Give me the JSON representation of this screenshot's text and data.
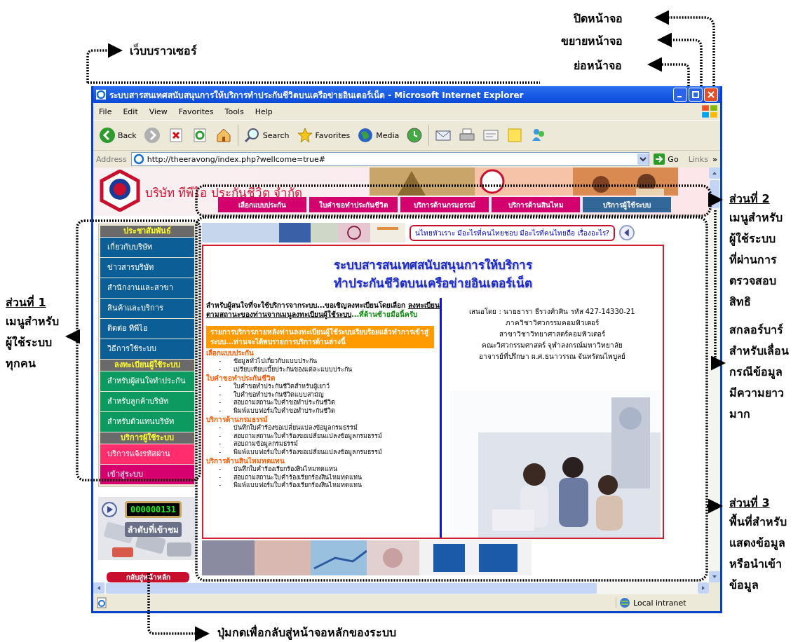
{
  "annotations": [
    {
      "kind": "plain",
      "lines": [
        "ปิดหน้าจอ"
      ]
    },
    {
      "kind": "plain",
      "lines": [
        "ขยายหน้าจอ"
      ]
    },
    {
      "kind": "plain",
      "lines": [
        "ย่อหน้าจอ"
      ]
    },
    {
      "kind": "plain",
      "lines": [
        "เว็บบราวเซอร์"
      ]
    },
    {
      "kind": "section",
      "heading": "ส่วนที่ 2",
      "lines": [
        "เมนูสำหรับ",
        "ผู้ใช้ระบบ",
        "ที่ผ่านการ",
        "ตรวจสอบ",
        "สิทธิ"
      ]
    },
    {
      "kind": "plain",
      "lines": [
        "สกลอร์บาร์",
        "สำหรับเลื่อน",
        "กรณีข้อมูล",
        "มีความยาว",
        "มาก"
      ]
    },
    {
      "kind": "section",
      "heading": "ส่วนที่ 3",
      "lines": [
        "พื้นที่สำหรับ",
        "แสดงข้อมูล",
        "หรือนำเข้า",
        "ข้อมูล"
      ]
    },
    {
      "kind": "section",
      "heading": "ส่วนที่ 1",
      "lines": [
        "เมนูสำหรับ",
        "ผู้ใช้ระบบ",
        "ทุกคน"
      ]
    },
    {
      "kind": "plain",
      "lines": [
        "ปุ่มกดเพื่อกลับสู่หน้าจอหลักของระบบ"
      ]
    }
  ],
  "browser": {
    "title": "ระบบสารสนเทศสนับสนุนการให้บริการทำประกันชีวิตบนเครือข่ายอินเตอร์เน็ต - Microsoft Internet Explorer",
    "menu": [
      "File",
      "Edit",
      "View",
      "Favorites",
      "Tools",
      "Help"
    ],
    "toolbar": [
      {
        "kind": "back",
        "label": "Back"
      },
      {
        "kind": "forward"
      },
      {
        "kind": "stop"
      },
      {
        "kind": "refresh"
      },
      {
        "kind": "home"
      },
      {
        "kind": "search",
        "label": "Search"
      },
      {
        "kind": "favorites",
        "label": "Favorites"
      },
      {
        "kind": "media",
        "label": "Media"
      },
      {
        "kind": "history"
      },
      {
        "kind": "mail"
      },
      {
        "kind": "print"
      },
      {
        "kind": "edit"
      },
      {
        "kind": "note"
      },
      {
        "kind": "messenger"
      }
    ],
    "address": {
      "label": "Address",
      "url": "http://theeravong/index.php?wellcome=true#",
      "go": "Go",
      "links": "Links",
      "more": "»"
    },
    "status": "Local intranet"
  },
  "site": {
    "company": "บริษัท ทีพีไอ ประกันชีวิต จำกัด",
    "tabs": [
      {
        "label": "เลือกแบบประกัน",
        "selected": false
      },
      {
        "label": "ใบคำขอทำประกันชีวิต",
        "selected": false
      },
      {
        "label": "บริการด้านกรมธรรม์",
        "selected": false
      },
      {
        "label": "บริการด้านสินไหม",
        "selected": false
      },
      {
        "label": "บริการผู้ใช้ระบบ",
        "selected": true
      }
    ],
    "sidebar": [
      {
        "title": "ประชาสัมพันธ์",
        "items": [
          {
            "label": "เกี่ยวกับบริษัท",
            "color": "#0b5e96"
          },
          {
            "label": "ข่าวสารบริษัท",
            "color": "#0b5e96"
          },
          {
            "label": "สำนักงานและสาขา",
            "color": "#0b5e96"
          },
          {
            "label": "สินค้าและบริการ",
            "color": "#0b5e96"
          },
          {
            "label": "ติดต่อ ทีพีไอ",
            "color": "#0b5e96"
          },
          {
            "label": "วิธีการใช้ระบบ",
            "color": "#0b5e96"
          }
        ]
      },
      {
        "title": "ลงทะเบียนผู้ใช้ระบบ",
        "items": [
          {
            "label": "สำหรับผู้สนใจทำประกัน",
            "color": "#0d9a60"
          },
          {
            "label": "สำหรับลูกค้าบริษัท",
            "color": "#0d9a60"
          },
          {
            "label": "สำหรับตัวแทนบริษัท",
            "color": "#0d9a60"
          }
        ]
      },
      {
        "title": "บริการผู้ใช้ระบบ",
        "items": [
          {
            "label": "บริการแจ้งรหัสผ่าน",
            "color": "#ff2d6e"
          },
          {
            "label": "เข้าสู่ระบบ",
            "color": "#d6006e"
          }
        ]
      }
    ],
    "counter": {
      "value": "000000131",
      "label": "ลำดับที่เข้าชม"
    },
    "home_button": "กลับสู่หน้าหลัก",
    "ticker": "นไทยหัวเราะ มีอะไรที่คนไทยชอบ มีอะไรที่คนไทยถือ เรื่องอะไร?",
    "main": {
      "bullet": "-",
      "title": [
        "ระบบสารสนเทศสนับสนุนการให้บริการ",
        "ทำประกันชีวิตบนเครือข่ายอินเตอร์เน็ต"
      ],
      "intro": [
        {
          "kind": "plain",
          "text": "สำหรับผู้สนใจที่จะใช้บริการจากระบบ...ขอเชิญลงทะเบียนโดยเลือก "
        },
        {
          "kind": "underline",
          "text": "ลงทะเบียนตามสถานะของท่านจากเมนูลงทะเบียนผู้ใช้ระบบ"
        },
        {
          "kind": "green",
          "text": "...ที่ด้านซ้ายมือนี้ครับ"
        }
      ],
      "notice": "รายการบริการภายหลังท่านลงทะเบียนผู้ใช้ระบบเรียบร้อยแล้วทำการเข้าสู่ระบบ...ท่านจะได้พบรายการบริการด้านล่างนี้",
      "sections": [
        {
          "title": "เลือกแบบประกัน",
          "items": [
            "ข้อมูลทั่วไปเกี่ยวกับแบบประกัน",
            "เปรียบเทียบเบี้ยประกันของแต่ละแบบประกัน"
          ]
        },
        {
          "title": "ใบคำขอทำประกันชีวิต",
          "items": [
            "ใบคำขอทำประกันชีวิตสำหรับผู้เยาว์",
            "ใบคำขอทำประกันชีวิตแบบสามัญ",
            "สอบถามสถานะใบคำขอทำประกันชีวิต",
            "พิมพ์แบบฟอร์มใบคำขอทำประกันชีวิต"
          ]
        },
        {
          "title": "บริการด้านกรมธรรม์",
          "items": [
            "บันทึกใบคำร้องขอเปลี่ยนแปลงข้อมูลกรมธรรม์",
            "สอบถามสถานะใบคำร้องขอเปลี่ยนแปลงข้อมูลกรมธรรม์",
            "สอบถามข้อมูลกรมธรรม์",
            "พิมพ์แบบฟอร์มใบคำร้องขอเปลี่ยนแปลงข้อมูลกรมธรรม์"
          ]
        },
        {
          "title": "บริการด้านสินไหมทดแทน",
          "items": [
            "บันทึกใบคำร้องเรียกร้องสินไหมทดแทน",
            "สอบถามสถานะใบคำร้องเรียกร้องสินไหมทดแทน",
            "พิมพ์แบบฟอร์มใบคำร้องเรียกร้องสินไหมทดแทน"
          ]
        }
      ],
      "credits": [
        "เสนอโดย : นายธารา ธีรวงศ์วศิน รหัส 427-14330-21",
        "ภาควิชาวิศวกรรมคอมพิวเตอร์",
        "สาขาวิชาวิทยาศาสตร์คอมพิวเตอร์",
        "คณะวิศวกรรมศาสตร์ จุฬาลงกรณ์มหาวิทยาลัย",
        "อาจารย์ที่ปรึกษา ผ.ศ.ธนาวรรณ จันทรัตนไพบูลย์"
      ]
    }
  }
}
